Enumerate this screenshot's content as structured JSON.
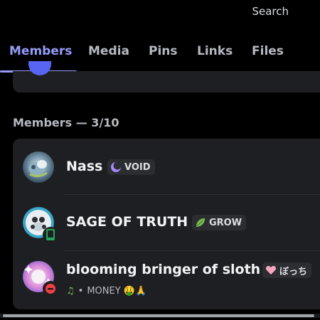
{
  "header": {
    "search_label": "Search"
  },
  "tabs": [
    {
      "label": "Members",
      "active": true
    },
    {
      "label": "Media",
      "active": false
    },
    {
      "label": "Pins",
      "active": false
    },
    {
      "label": "Links",
      "active": false
    },
    {
      "label": "Files",
      "active": false
    }
  ],
  "members_section": {
    "title": "Members — 3/10",
    "members": [
      {
        "name": "Nass",
        "role": {
          "icon": "crescent-moon-icon",
          "label": "VOID",
          "color": "#a78bfa"
        },
        "status": null
      },
      {
        "name": "SAGE OF TRUTH",
        "role": {
          "icon": "leaf-icon",
          "label": "GROW",
          "color": "#7cc04f"
        },
        "status": null,
        "device": "mobile-icon"
      },
      {
        "name": "blooming bringer of sloth",
        "role": {
          "icon": "pink-heart-icon",
          "label": "ぼっち",
          "color": "#f6a5c0"
        },
        "status": {
          "prefix": "♫",
          "separator": "•",
          "text": "MONEY 🤑🙏"
        },
        "presence": "dnd"
      }
    ]
  },
  "colors": {
    "accent": "#949cf7",
    "background": "#000000",
    "card": "#1e1f22",
    "online": "#23a55a",
    "dnd": "#f23f43"
  }
}
